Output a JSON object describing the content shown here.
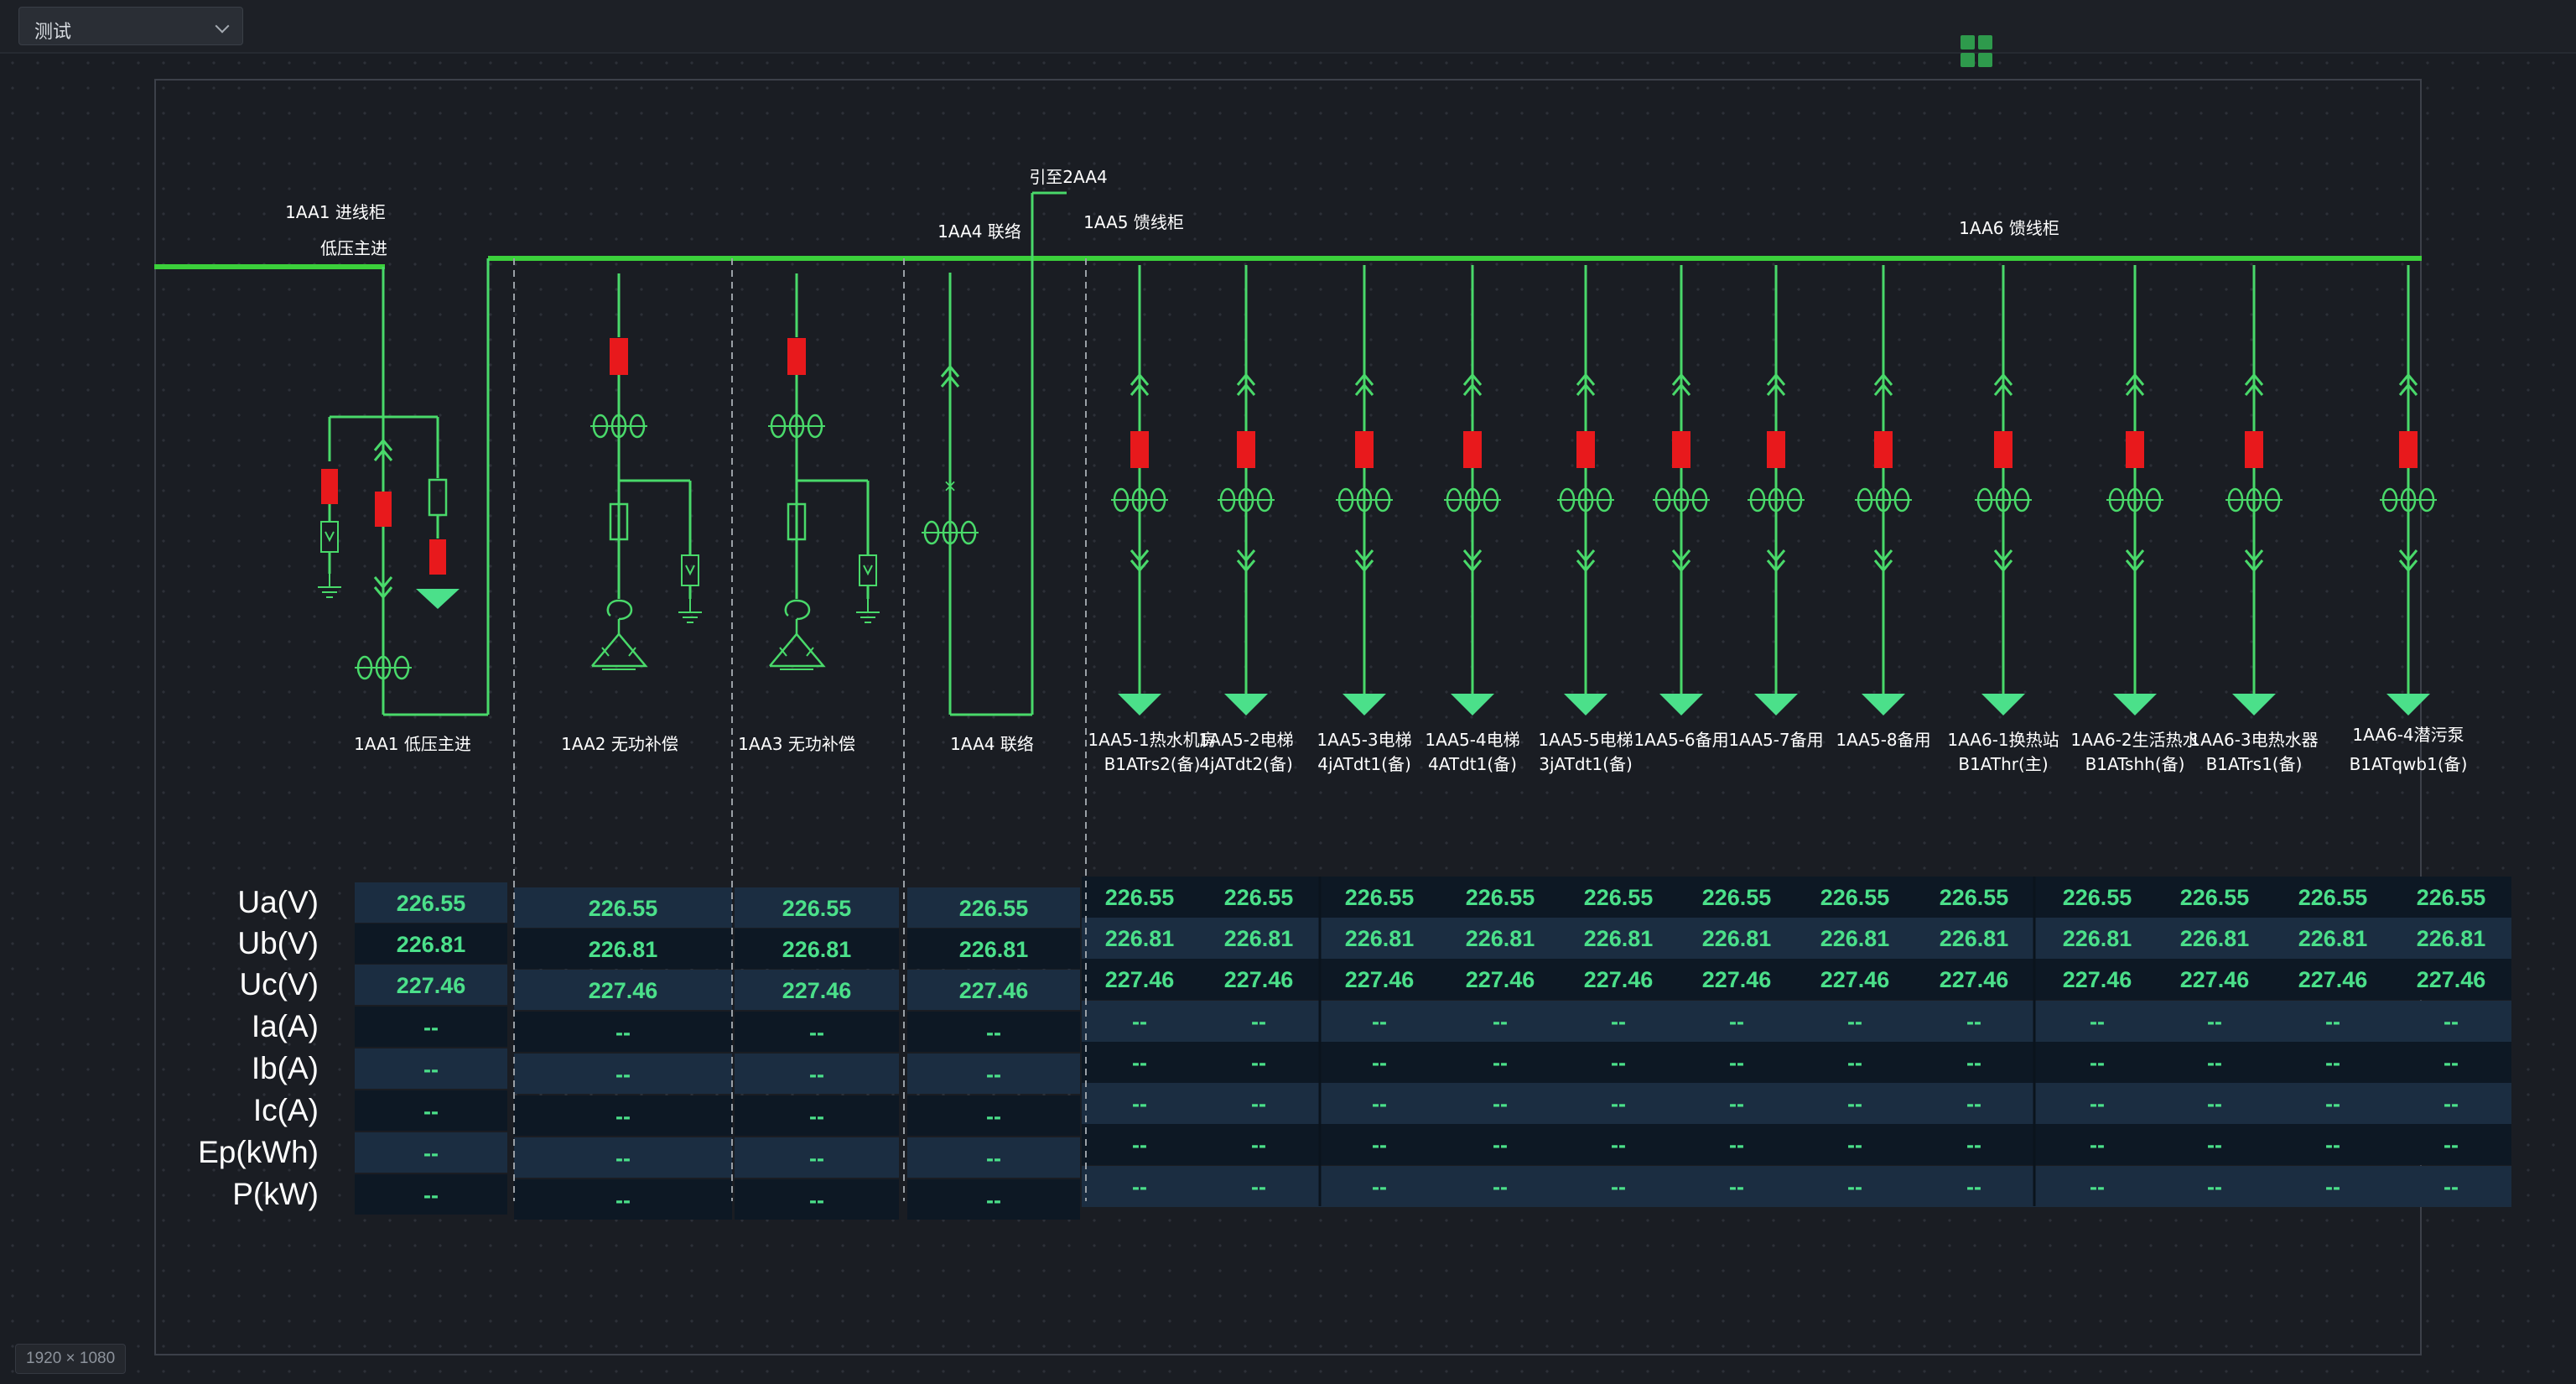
{
  "toolbar": {
    "dropdown_value": "测试",
    "dropdown_icon": "chevron-down-icon",
    "apps_icon": "grid-icon"
  },
  "canvas_size_label": "1920 × 1080",
  "colors": {
    "bus": "#3bd03b",
    "line": "#49d96a",
    "breaker": "#e8191c",
    "value": "#4be08a",
    "divider": "#9aa0a6"
  },
  "diagram": {
    "incoming_top_label": "1AA1 进线柜",
    "incoming_sub_label": "低压主进",
    "tie_top_label": "1AA4 联络",
    "tie_route_label": "引至2AA4",
    "feeder5_label": "1AA5 馈线柜",
    "feeder6_label": "1AA6 馈线柜",
    "cabinets": [
      {
        "id": "c1",
        "label": "1AA1 低压主进"
      },
      {
        "id": "c2",
        "label": "1AA2 无功补偿"
      },
      {
        "id": "c3",
        "label": "1AA3 无功补偿"
      },
      {
        "id": "c4",
        "label": "1AA4 联络"
      }
    ],
    "feeders": [
      {
        "line1": "1AA5-1热水机房",
        "line2": "B1ATrs2(备)"
      },
      {
        "line1": "1AA5-2电梯",
        "line2": "4jATdt2(备)"
      },
      {
        "line1": "1AA5-3电梯",
        "line2": "4jATdt1(备)"
      },
      {
        "line1": "1AA5-4电梯",
        "line2": "4ATdt1(备)"
      },
      {
        "line1": "1AA5-5电梯",
        "line2": "3jATdt1(备)"
      },
      {
        "line1": "1AA5-6备用",
        "line2": ""
      },
      {
        "line1": "1AA5-7备用",
        "line2": ""
      },
      {
        "line1": "1AA5-8备用",
        "line2": ""
      },
      {
        "line1": "1AA6-1换热站",
        "line2": "B1AThr(主)"
      },
      {
        "line1": "1AA6-2生活热水",
        "line2": "B1ATshh(备)"
      },
      {
        "line1": "1AA6-3电热水器",
        "line2": "B1ATrs1(备)"
      },
      {
        "line1": "1AA6-4潜污泵",
        "line2": "B1ATqwb1(备)"
      }
    ]
  },
  "table": {
    "row_labels": [
      "Ua(V)",
      "Ub(V)",
      "Uc(V)",
      "Ia(A)",
      "Ib(A)",
      "Ic(A)",
      "Ep(kWh)",
      "P(kW)"
    ],
    "cabinet_columns": [
      [
        "226.55",
        "226.81",
        "227.46",
        "--",
        "--",
        "--",
        "--",
        "--"
      ],
      [
        "226.55",
        "226.81",
        "227.46",
        "--",
        "--",
        "--",
        "--",
        "--"
      ],
      [
        "226.55",
        "226.81",
        "227.46",
        "--",
        "--",
        "--",
        "--",
        "--"
      ],
      [
        "226.55",
        "226.81",
        "227.46",
        "--",
        "--",
        "--",
        "--",
        "--"
      ]
    ],
    "feeder_columns": [
      [
        "226.55",
        "226.81",
        "227.46",
        "--",
        "--",
        "--",
        "--",
        "--"
      ],
      [
        "226.55",
        "226.81",
        "227.46",
        "--",
        "--",
        "--",
        "--",
        "--"
      ],
      [
        "226.55",
        "226.81",
        "227.46",
        "--",
        "--",
        "--",
        "--",
        "--"
      ],
      [
        "226.55",
        "226.81",
        "227.46",
        "--",
        "--",
        "--",
        "--",
        "--"
      ],
      [
        "226.55",
        "226.81",
        "227.46",
        "--",
        "--",
        "--",
        "--",
        "--"
      ],
      [
        "226.55",
        "226.81",
        "227.46",
        "--",
        "--",
        "--",
        "--",
        "--"
      ],
      [
        "226.55",
        "226.81",
        "227.46",
        "--",
        "--",
        "--",
        "--",
        "--"
      ],
      [
        "226.55",
        "226.81",
        "227.46",
        "--",
        "--",
        "--",
        "--",
        "--"
      ],
      [
        "226.55",
        "226.81",
        "227.46",
        "--",
        "--",
        "--",
        "--",
        "--"
      ],
      [
        "226.55",
        "226.81",
        "227.46",
        "--",
        "--",
        "--",
        "--",
        "--"
      ],
      [
        "226.55",
        "226.81",
        "227.46",
        "--",
        "--",
        "--",
        "--",
        "--"
      ],
      [
        "226.55",
        "226.81",
        "227.46",
        "--",
        "--",
        "--",
        "--",
        "--"
      ]
    ]
  }
}
